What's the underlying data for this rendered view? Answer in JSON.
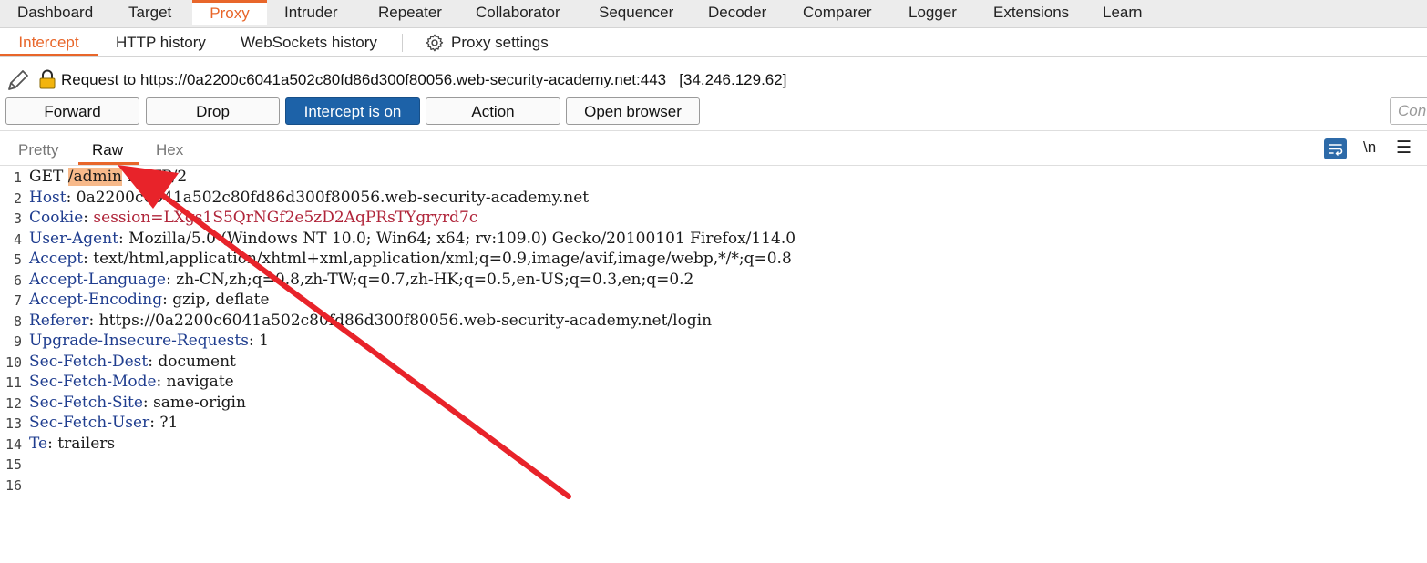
{
  "top_tabs": [
    "Dashboard",
    "Target",
    "Proxy",
    "Intruder",
    "Repeater",
    "Collaborator",
    "Sequencer",
    "Decoder",
    "Comparer",
    "Logger",
    "Extensions",
    "Learn"
  ],
  "active_top_tab": "Proxy",
  "sub_tabs": [
    "Intercept",
    "HTTP history",
    "WebSockets history"
  ],
  "proxy_settings_label": "Proxy settings",
  "request_header": {
    "text": "Request to https://0a2200c6041a502c80fd86d300f80056.web-security-academy.net:443",
    "ip": "[34.246.129.62]"
  },
  "buttons": {
    "forward": "Forward",
    "drop": "Drop",
    "intercept": "Intercept is on",
    "action": "Action",
    "open_browser": "Open browser"
  },
  "comment_placeholder": "Con",
  "view_tabs": [
    "Pretty",
    "Raw",
    "Hex"
  ],
  "newline_icon_label": "\\n",
  "request_lines": [
    {
      "num": "1",
      "pre": "GET ",
      "highlight": "/admin",
      "post": " HTTP/2"
    },
    {
      "num": "2",
      "name": "Host",
      "sep": ": ",
      "value": "0a2200c6041a502c80fd86d300f80056.web-security-academy.net"
    },
    {
      "num": "3",
      "name": "Cookie",
      "sep": ": ",
      "value": "session=LXgs1S5QrNGf2e5zD2AqPRsTYgryrd7c"
    },
    {
      "num": "4",
      "name": "User-Agent",
      "sep": ": ",
      "value": "Mozilla/5.0 (Windows NT 10.0; Win64; x64; rv:109.0) Gecko/20100101 Firefox/114.0"
    },
    {
      "num": "5",
      "name": "Accept",
      "sep": ": ",
      "value": "text/html,application/xhtml+xml,application/xml;q=0.9,image/avif,image/webp,*/*;q=0.8"
    },
    {
      "num": "6",
      "name": "Accept-Language",
      "sep": ": ",
      "value": "zh-CN,zh;q=0.8,zh-TW;q=0.7,zh-HK;q=0.5,en-US;q=0.3,en;q=0.2"
    },
    {
      "num": "7",
      "name": "Accept-Encoding",
      "sep": ": ",
      "value": "gzip, deflate"
    },
    {
      "num": "8",
      "name": "Referer",
      "sep": ": ",
      "value": "https://0a2200c6041a502c80fd86d300f80056.web-security-academy.net/login"
    },
    {
      "num": "9",
      "name": "Upgrade-Insecure-Requests",
      "sep": ": ",
      "value": "1"
    },
    {
      "num": "10",
      "name": "Sec-Fetch-Dest",
      "sep": ": ",
      "value": "document"
    },
    {
      "num": "11",
      "name": "Sec-Fetch-Mode",
      "sep": ": ",
      "value": "navigate"
    },
    {
      "num": "12",
      "name": "Sec-Fetch-Site",
      "sep": ": ",
      "value": "same-origin"
    },
    {
      "num": "13",
      "name": "Sec-Fetch-User",
      "sep": ": ",
      "value": "?1"
    },
    {
      "num": "14",
      "name": "Te",
      "sep": ": ",
      "value": "trailers"
    },
    {
      "num": "15"
    },
    {
      "num": "16"
    }
  ],
  "colors": {
    "accent": "#e8662a",
    "primary_button": "#1d62a8",
    "header_name": "#1f3d8f",
    "cookie_value": "#b0253a",
    "selection_highlight": "#f7b98a",
    "annotation_arrow": "#e8232a"
  }
}
